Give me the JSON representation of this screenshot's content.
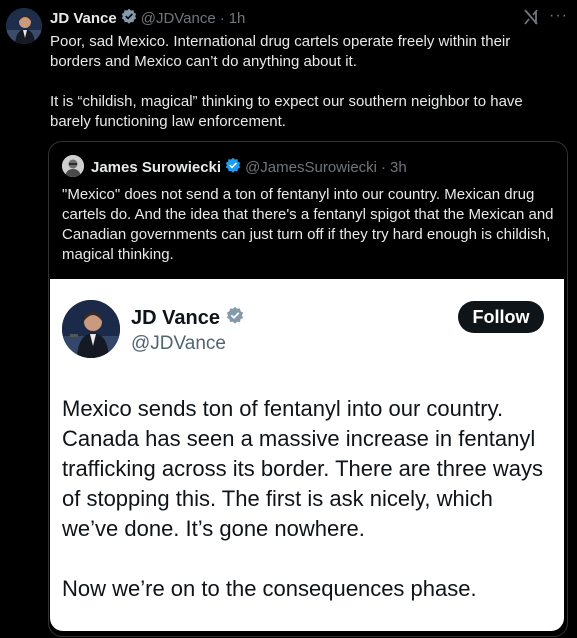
{
  "main_tweet": {
    "author_name": "JD Vance",
    "author_handle": "@JDVance",
    "separator": "·",
    "time": "1h",
    "paragraph_1": "Poor, sad Mexico. International drug cartels operate freely within their borders and Mexico can’t do anything about it.",
    "paragraph_2": "It is “childish, magical” thinking to expect our southern neighbor to have barely functioning law enforcement.",
    "grok_icon": "grok-icon",
    "more_icon": "more-options-icon"
  },
  "quoted_tweet": {
    "author_name": "James Surowiecki",
    "author_handle": "@JamesSurowiecki",
    "separator": "·",
    "time": "3h",
    "text": "\"Mexico\" does not send a ton of fentanyl into our country. Mexican drug cartels do. And the idea that there's a fentanyl spigot that the Mexican and Canadian governments can just turn off if they try hard enough is childish, magical thinking."
  },
  "embedded_card": {
    "author_name": "JD Vance",
    "author_handle": "@JDVance",
    "follow_label": "Follow",
    "paragraph_1": "Mexico sends ton of fentanyl into our country. Canada has seen a massive increase in fentanyl trafficking across its border. There are three ways of stopping this. The first is ask nicely, which we’ve done. It’s gone nowhere.",
    "paragraph_2": "Now we’re on to the consequences phase."
  },
  "colors": {
    "background": "#000000",
    "text_primary": "#e7e9ea",
    "text_secondary": "#71767b",
    "verified_blue": "#1d9bf0",
    "verified_gray": "#829aab",
    "card_background": "#ffffff",
    "follow_button": "#0f1419"
  }
}
